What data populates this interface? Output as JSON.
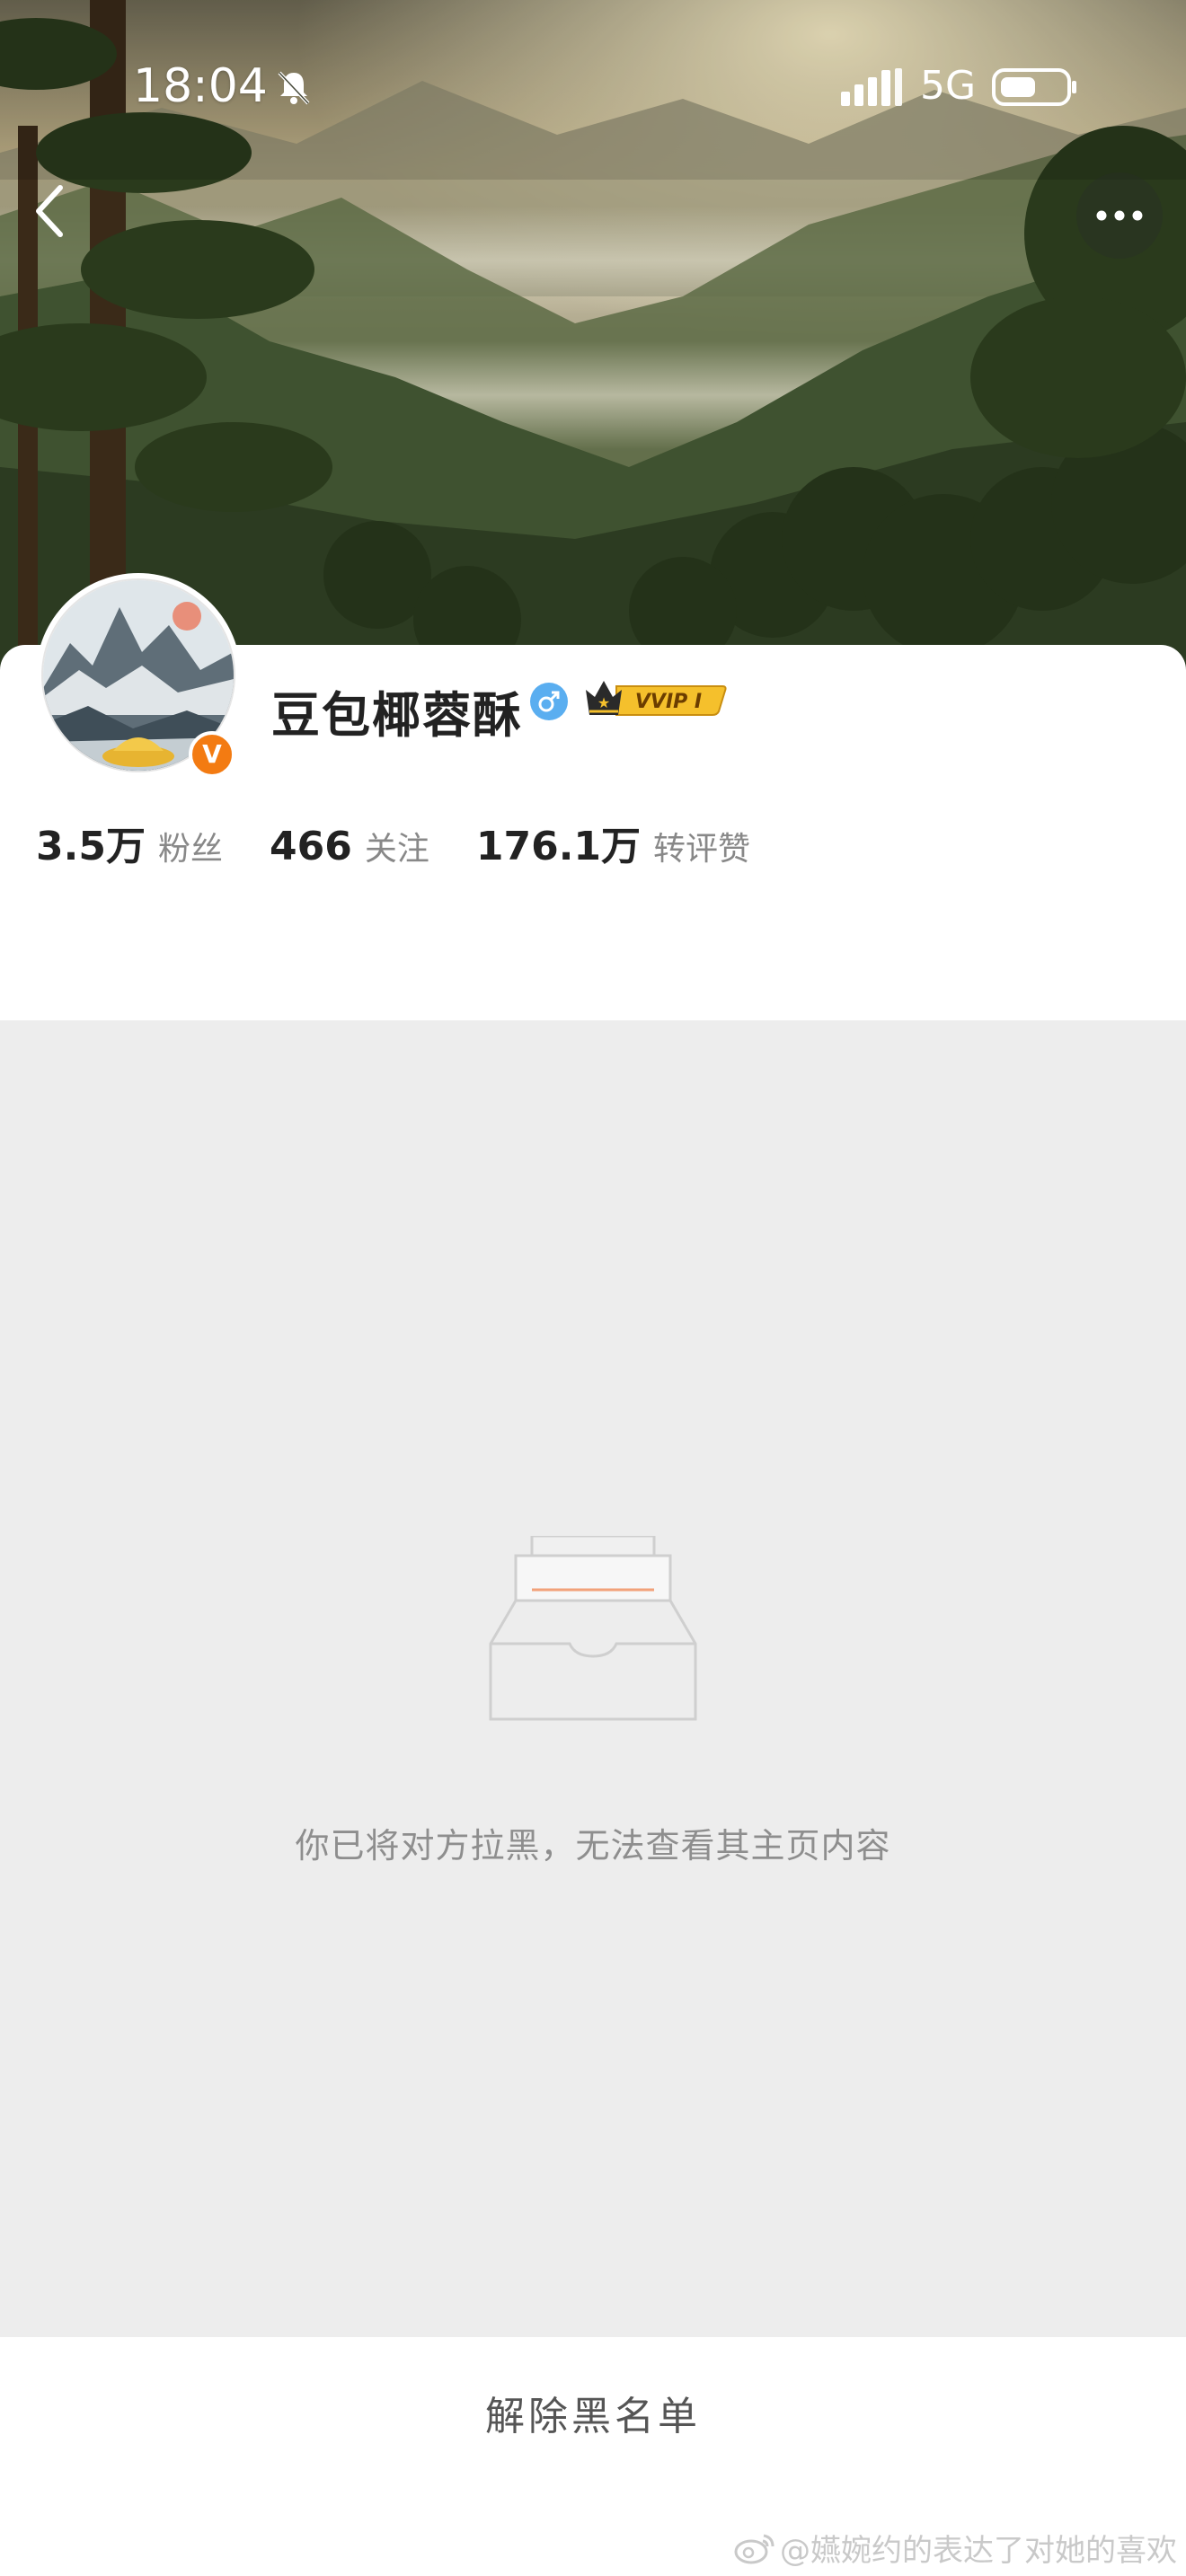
{
  "status_bar": {
    "time": "18:04",
    "network": "5G",
    "icons": [
      "bell-muted-icon",
      "signal-icon",
      "battery-icon"
    ]
  },
  "nav": {
    "back_icon": "chevron-left-icon",
    "more_icon": "more-dots-icon"
  },
  "profile": {
    "username": "豆包椰蓉酥",
    "gender": "male",
    "vip_label": "VVIP I",
    "verified_mark": "V",
    "stats": [
      {
        "value": "3.5万",
        "label": "粉丝"
      },
      {
        "value": "466",
        "label": "关注"
      },
      {
        "value": "176.1万",
        "label": "转评赞"
      }
    ]
  },
  "content": {
    "empty_message": "你已将对方拉黑，无法查看其主页内容",
    "empty_icon": "empty-inbox-icon"
  },
  "footer": {
    "unblock_label": "解除黑名单",
    "watermark": "@嬿婉约的表达了对她的喜欢"
  },
  "colors": {
    "accent_orange": "#f37b12",
    "gender_blue": "#5aaef0",
    "vip_gold": "#f5c02c",
    "background": "#ededed"
  }
}
